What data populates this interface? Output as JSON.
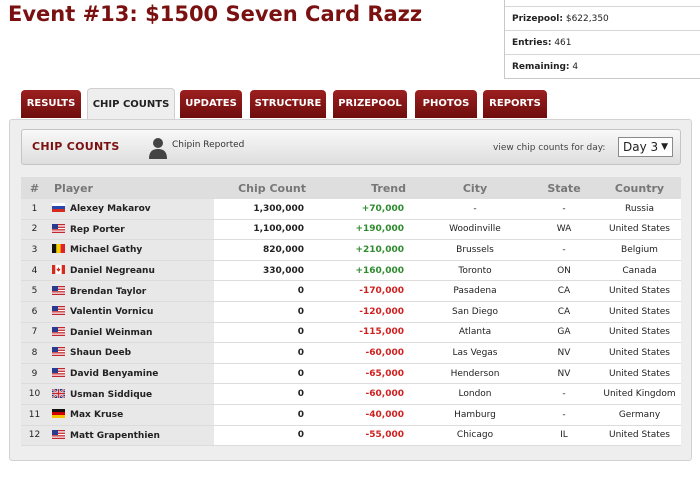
{
  "event": {
    "title": "Event #13: $1500 Seven Card Razz"
  },
  "stats": [
    {
      "label": "Prizepool:",
      "value": "$622,350"
    },
    {
      "label": "Entries:",
      "value": "461"
    },
    {
      "label": "Remaining:",
      "value": "4"
    }
  ],
  "tabs": [
    {
      "label": "RESULTS",
      "active": false
    },
    {
      "label": "CHIP COUNTS",
      "active": true
    },
    {
      "label": "UPDATES",
      "active": false
    },
    {
      "label": "STRUCTURE",
      "active": false
    },
    {
      "label": "PRIZEPOOL",
      "active": false
    },
    {
      "label": "PHOTOS",
      "active": false
    },
    {
      "label": "REPORTS",
      "active": false
    }
  ],
  "panel": {
    "title": "CHIP COUNTS",
    "chipin_label": "Chipin Reported",
    "view_label": "view chip counts for day:",
    "day_selected": "Day 3"
  },
  "table": {
    "headers": [
      "#",
      "Player",
      "Chip Count",
      "Trend",
      "City",
      "State",
      "Country"
    ],
    "rows": [
      {
        "rank": "1",
        "flag": "russia",
        "player": "Alexey Makarov",
        "chips": "1,300,000",
        "trend": "+70,000",
        "trend_dir": "up",
        "city": "-",
        "state": "-",
        "country": "Russia"
      },
      {
        "rank": "2",
        "flag": "usa",
        "player": "Rep Porter",
        "chips": "1,100,000",
        "trend": "+190,000",
        "trend_dir": "up",
        "city": "Woodinville",
        "state": "WA",
        "country": "United States"
      },
      {
        "rank": "3",
        "flag": "belgium",
        "player": "Michael Gathy",
        "chips": "820,000",
        "trend": "+210,000",
        "trend_dir": "up",
        "city": "Brussels",
        "state": "-",
        "country": "Belgium"
      },
      {
        "rank": "4",
        "flag": "canada",
        "player": "Daniel Negreanu",
        "chips": "330,000",
        "trend": "+160,000",
        "trend_dir": "up",
        "city": "Toronto",
        "state": "ON",
        "country": "Canada"
      },
      {
        "rank": "5",
        "flag": "usa",
        "player": "Brendan Taylor",
        "chips": "0",
        "trend": "-170,000",
        "trend_dir": "down",
        "city": "Pasadena",
        "state": "CA",
        "country": "United States"
      },
      {
        "rank": "6",
        "flag": "usa",
        "player": "Valentin Vornicu",
        "chips": "0",
        "trend": "-120,000",
        "trend_dir": "down",
        "city": "San Diego",
        "state": "CA",
        "country": "United States"
      },
      {
        "rank": "7",
        "flag": "usa",
        "player": "Daniel Weinman",
        "chips": "0",
        "trend": "-115,000",
        "trend_dir": "down",
        "city": "Atlanta",
        "state": "GA",
        "country": "United States"
      },
      {
        "rank": "8",
        "flag": "usa",
        "player": "Shaun Deeb",
        "chips": "0",
        "trend": "-60,000",
        "trend_dir": "down",
        "city": "Las Vegas",
        "state": "NV",
        "country": "United States"
      },
      {
        "rank": "9",
        "flag": "usa",
        "player": "David Benyamine",
        "chips": "0",
        "trend": "-65,000",
        "trend_dir": "down",
        "city": "Henderson",
        "state": "NV",
        "country": "United States"
      },
      {
        "rank": "10",
        "flag": "uk",
        "player": "Usman Siddique",
        "chips": "0",
        "trend": "-60,000",
        "trend_dir": "down",
        "city": "London",
        "state": "-",
        "country": "United Kingdom"
      },
      {
        "rank": "11",
        "flag": "germany",
        "player": "Max Kruse",
        "chips": "0",
        "trend": "-40,000",
        "trend_dir": "down",
        "city": "Hamburg",
        "state": "-",
        "country": "Germany"
      },
      {
        "rank": "12",
        "flag": "usa",
        "player": "Matt Grapenthien",
        "chips": "0",
        "trend": "-55,000",
        "trend_dir": "down",
        "city": "Chicago",
        "state": "IL",
        "country": "United States"
      }
    ]
  },
  "colors": {
    "brand": "#7a1010",
    "tab_bg": "#8c1818",
    "trend_up": "#2e8b2e",
    "trend_down": "#d02020"
  }
}
